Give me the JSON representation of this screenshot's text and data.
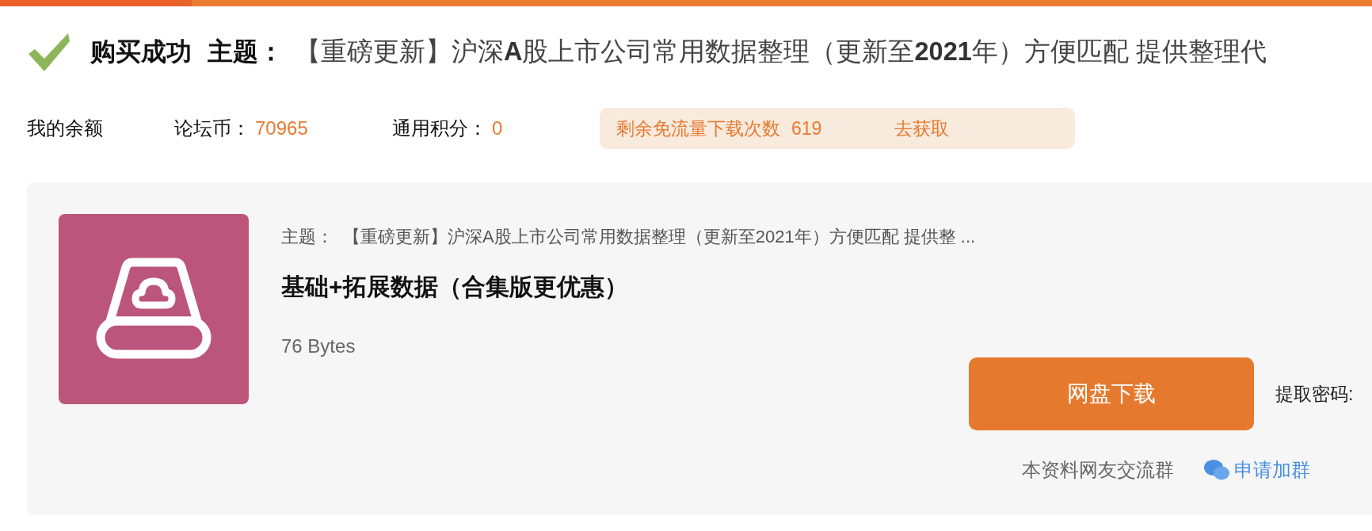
{
  "header": {
    "status": "购买成功",
    "topic_label": "主题：",
    "topic": "【重磅更新】沪深**A**股上市公司常用数据整理（更新至**2021**年）方便匹配 提供整理代"
  },
  "balance": {
    "label": "我的余额",
    "items": [
      {
        "label": "论坛币：",
        "value": "70965"
      },
      {
        "label": "通用积分：",
        "value": "0"
      }
    ]
  },
  "quota": {
    "label": "剩余免流量下载次数",
    "value": "619",
    "link": "去获取"
  },
  "resource": {
    "topic_label": "主题：",
    "topic": "【重磅更新】沪深A股上市公司常用数据整理（更新至2021年）方便匹配 提供整 ...",
    "title": "基础+拓展数据（合集版更优惠）",
    "size": "76 Bytes",
    "download_button": "网盘下载",
    "password_label": "提取密码:",
    "group_label": "本资料网友交流群",
    "group_link": "申请加群"
  }
}
